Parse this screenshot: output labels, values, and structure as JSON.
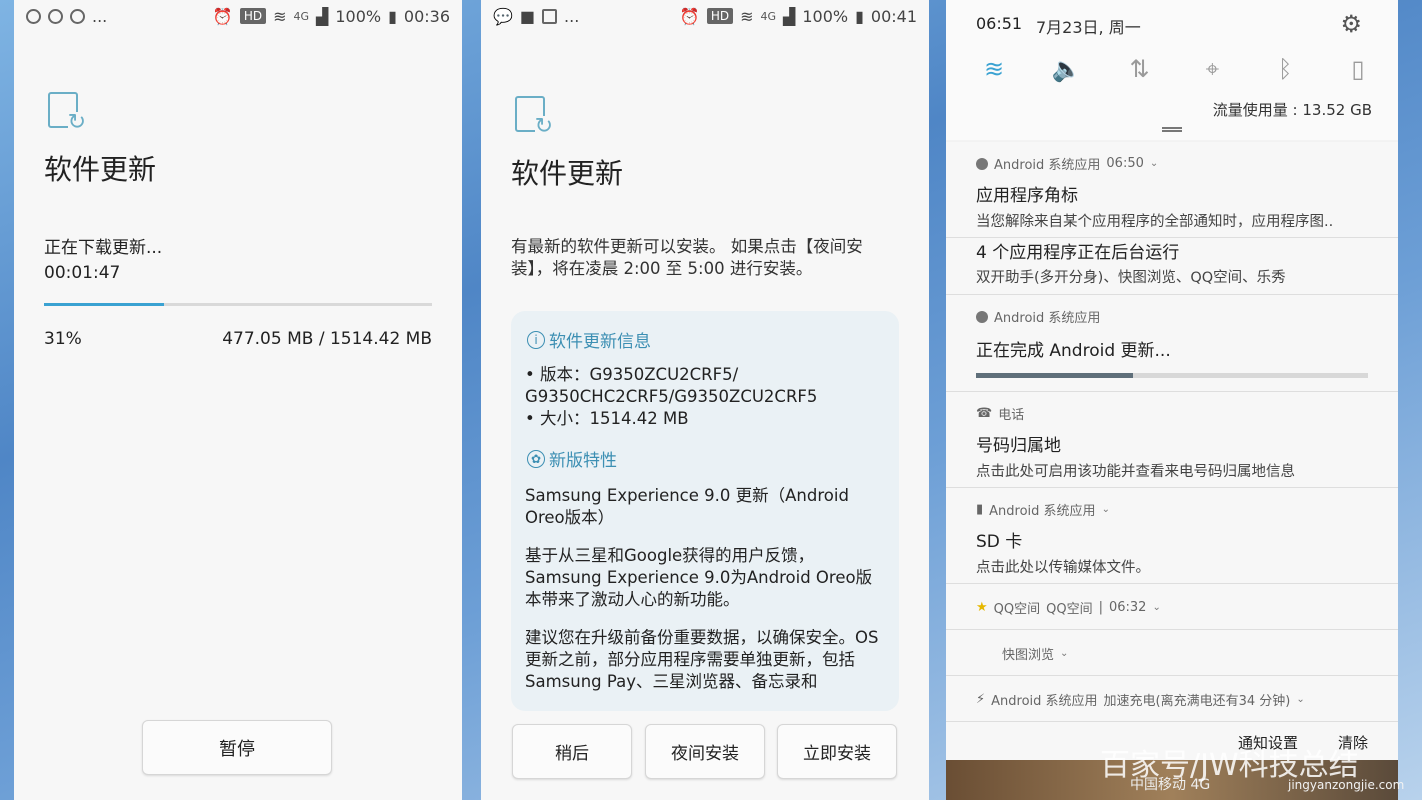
{
  "panel1": {
    "status_time": "00:36",
    "status_battery": "100%",
    "status_hd": "HD",
    "status_net": "4G",
    "status_more": "...",
    "title": "软件更新",
    "download_status": "正在下载更新...",
    "elapsed": "00:01:47",
    "percent_text": "31%",
    "progress_fraction": 0.31,
    "size_text": "477.05 MB / 1514.42 MB",
    "pause_label": "暂停"
  },
  "panel2": {
    "status_time": "00:41",
    "status_battery": "100%",
    "status_hd": "HD",
    "status_net": "4G",
    "status_more": "...",
    "title": "软件更新",
    "intro": "有最新的软件更新可以安装。 如果点击【夜间安装】，将在凌晨 2:00 至 5:00 进行安装。",
    "info_heading": "软件更新信息",
    "version_line1": "• 版本：G9350ZCU2CRF5/",
    "version_line2": "G9350CHC2CRF5/G9350ZCU2CRF5",
    "size_line": "• 大小：1514.42 MB",
    "features_heading": "新版特性",
    "features_p1": "Samsung Experience 9.0 更新（Android Oreo版本）",
    "features_p2": "基于从三星和Google获得的用户反馈，Samsung Experience 9.0为Android Oreo版本带来了激动人心的新功能。",
    "features_p3": "建议您在升级前备份重要数据，以确保安全。OS更新之前，部分应用程序需要单独更新，包括Samsung Pay、三星浏览器、备忘录和",
    "later_label": "稍后",
    "night_label": "夜间安装",
    "now_label": "立即安装"
  },
  "panel3": {
    "time": "06:51",
    "date": "7月23日, 周一",
    "data_usage": "流量使用量 : 13.52 GB",
    "notifications": [
      {
        "app": "Android 系统应用",
        "time": "06:50",
        "title": "应用程序角标",
        "text": "当您解除来自某个应用程序的全部通知时，应用程序图.."
      },
      {
        "title": "4 个应用程序正在后台运行",
        "text": "双开助手(多开分身)、快图浏览、QQ空间、乐秀"
      },
      {
        "app": "Android 系统应用",
        "title": "正在完成 Android 更新...",
        "progress_fraction": 0.4
      },
      {
        "app": "电话",
        "title": "号码归属地",
        "text": "点击此处可启用该功能并查看来电号码归属地信息"
      },
      {
        "app": "Android 系统应用",
        "title": "SD 卡",
        "text": "点击此处以传输媒体文件。"
      },
      {
        "app": "QQ空间",
        "sub": "QQ空间",
        "time": "06:32"
      },
      {
        "app": "快图浏览"
      },
      {
        "app": "Android 系统应用",
        "sub": "加速充电(离充满电还有34 分钟)"
      }
    ],
    "notification_settings": "通知设置",
    "clear": "清除",
    "carrier": "中国移动 4G"
  },
  "watermark": "百家号/JW科技总结",
  "watermark_site": "jingyanzongjie.com",
  "colors": {
    "accent": "#3aa2d2",
    "icon_teal": "#6aaec6"
  }
}
